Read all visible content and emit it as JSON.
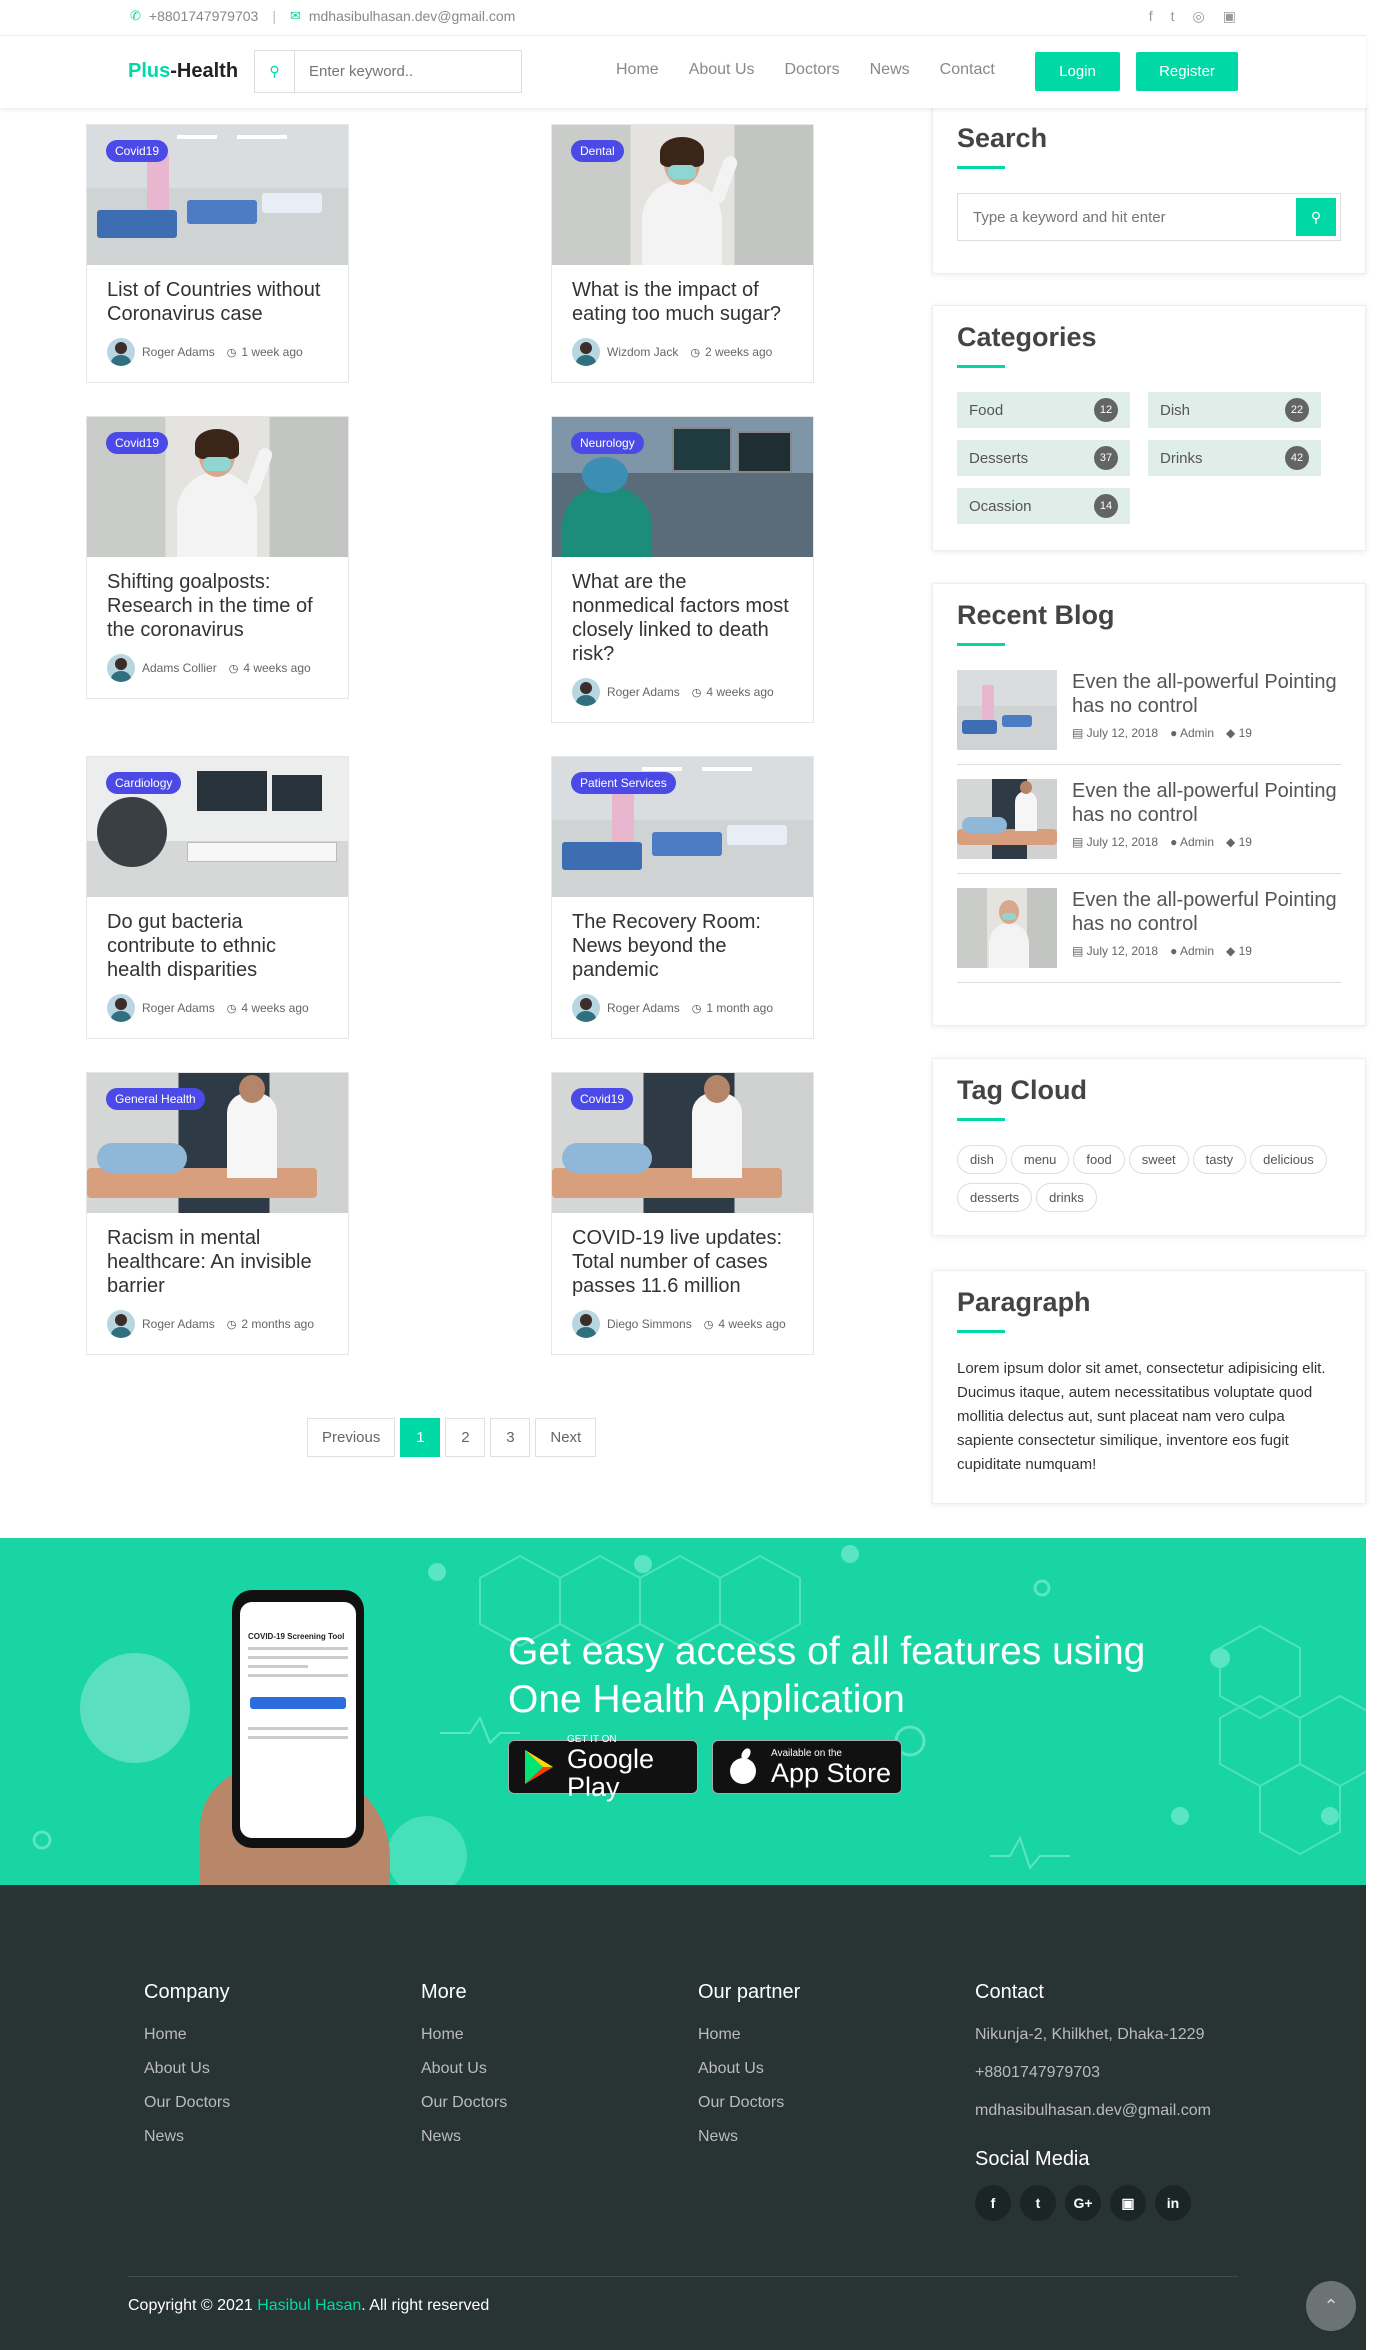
{
  "topbar": {
    "phone": "+8801747979703",
    "email": "mdhasibulhasan.dev@gmail.com",
    "social_icons": [
      "facebook-icon",
      "twitter-icon",
      "dribbble-icon",
      "instagram-icon"
    ]
  },
  "navbar": {
    "logo_part1": "Plus",
    "logo_part2": "-Health",
    "search_placeholder": "Enter keyword..",
    "links": [
      "Home",
      "About Us",
      "Doctors",
      "News",
      "Contact"
    ],
    "login": "Login",
    "register": "Register"
  },
  "posts": [
    {
      "category": "Covid19",
      "title": "List of Countries without Coronavirus case",
      "author": "Roger Adams",
      "time": "1 week ago"
    },
    {
      "category": "Dental",
      "title": "What is the impact of eating too much sugar?",
      "author": "Wizdom Jack",
      "time": "2 weeks ago"
    },
    {
      "category": "Covid19",
      "title": "Shifting goalposts: Research in the time of the coronavirus",
      "author": "Adams Collier",
      "time": "4 weeks ago"
    },
    {
      "category": "Neurology",
      "title": "What are the nonmedical factors most closely linked to death risk?",
      "author": "Roger Adams",
      "time": "4 weeks ago"
    },
    {
      "category": "Cardiology",
      "title": "Do gut bacteria contribute to ethnic health disparities",
      "author": "Roger Adams",
      "time": "4 weeks ago"
    },
    {
      "category": "Patient Services",
      "title": "The Recovery Room: News beyond the pandemic",
      "author": "Roger Adams",
      "time": "1 month ago"
    },
    {
      "category": "General Health",
      "title": "Racism in mental healthcare: An invisible barrier",
      "author": "Roger Adams",
      "time": "2 months ago"
    },
    {
      "category": "Covid19",
      "title": "COVID-19 live updates: Total number of cases passes 11.6 million",
      "author": "Diego Simmons",
      "time": "4 weeks ago"
    }
  ],
  "pagination": {
    "previous": "Previous",
    "pages": [
      "1",
      "2",
      "3"
    ],
    "next": "Next",
    "active": "1"
  },
  "sidebar": {
    "search": {
      "title": "Search",
      "placeholder": "Type a keyword and hit enter"
    },
    "categories": {
      "title": "Categories",
      "items": [
        {
          "name": "Food",
          "count": "12"
        },
        {
          "name": "Dish",
          "count": "22"
        },
        {
          "name": "Desserts",
          "count": "37"
        },
        {
          "name": "Drinks",
          "count": "42"
        },
        {
          "name": "Ocassion",
          "count": "14"
        }
      ]
    },
    "recent": {
      "title": "Recent Blog",
      "items": [
        {
          "title": "Even the all-powerful Pointing has no control",
          "date": "July 12, 2018",
          "author": "Admin",
          "comments": "19"
        },
        {
          "title": "Even the all-powerful Pointing has no control",
          "date": "July 12, 2018",
          "author": "Admin",
          "comments": "19"
        },
        {
          "title": "Even the all-powerful Pointing has no control",
          "date": "July 12, 2018",
          "author": "Admin",
          "comments": "19"
        }
      ]
    },
    "tags": {
      "title": "Tag Cloud",
      "items": [
        "dish",
        "menu",
        "food",
        "sweet",
        "tasty",
        "delicious",
        "desserts",
        "drinks"
      ]
    },
    "paragraph": {
      "title": "Paragraph",
      "text": "Lorem ipsum dolor sit amet, consectetur adipisicing elit. Ducimus itaque, autem necessitatibus voluptate quod mollitia delectus aut, sunt placeat nam vero culpa sapiente consectetur similique, inventore eos fugit cupiditate numquam!"
    }
  },
  "banner": {
    "headline": "Get easy access of all features using One Health Application",
    "phone_screen_title": "COVID-19 Screening Tool",
    "google_small": "GET IT ON",
    "google_large": "Google Play",
    "apple_small": "Available on the",
    "apple_large": "App Store"
  },
  "footer": {
    "company": {
      "title": "Company",
      "links": [
        "Home",
        "About Us",
        "Our Doctors",
        "News"
      ]
    },
    "more": {
      "title": "More",
      "links": [
        "Home",
        "About Us",
        "Our Doctors",
        "News"
      ]
    },
    "partner": {
      "title": "Our partner",
      "links": [
        "Home",
        "About Us",
        "Our Doctors",
        "News"
      ]
    },
    "contact": {
      "title": "Contact",
      "address": "Nikunja-2, Khilkhet, Dhaka-1229",
      "phone": "+8801747979703",
      "email": "mdhasibulhasan.dev@gmail.com"
    },
    "social_title": "Social Media",
    "social_icons": [
      "facebook-icon",
      "twitter-icon",
      "google-plus-icon",
      "instagram-icon",
      "linkedin-icon"
    ],
    "copyright_prefix": "Copyright © 2021 ",
    "copyright_name": "Hasibul Hasan",
    "copyright_suffix": ". All right reserved"
  },
  "colors": {
    "accent": "#00d9a5",
    "badge": "#4b4ae6",
    "footer": "#283333",
    "banner": "#19d4a3"
  }
}
